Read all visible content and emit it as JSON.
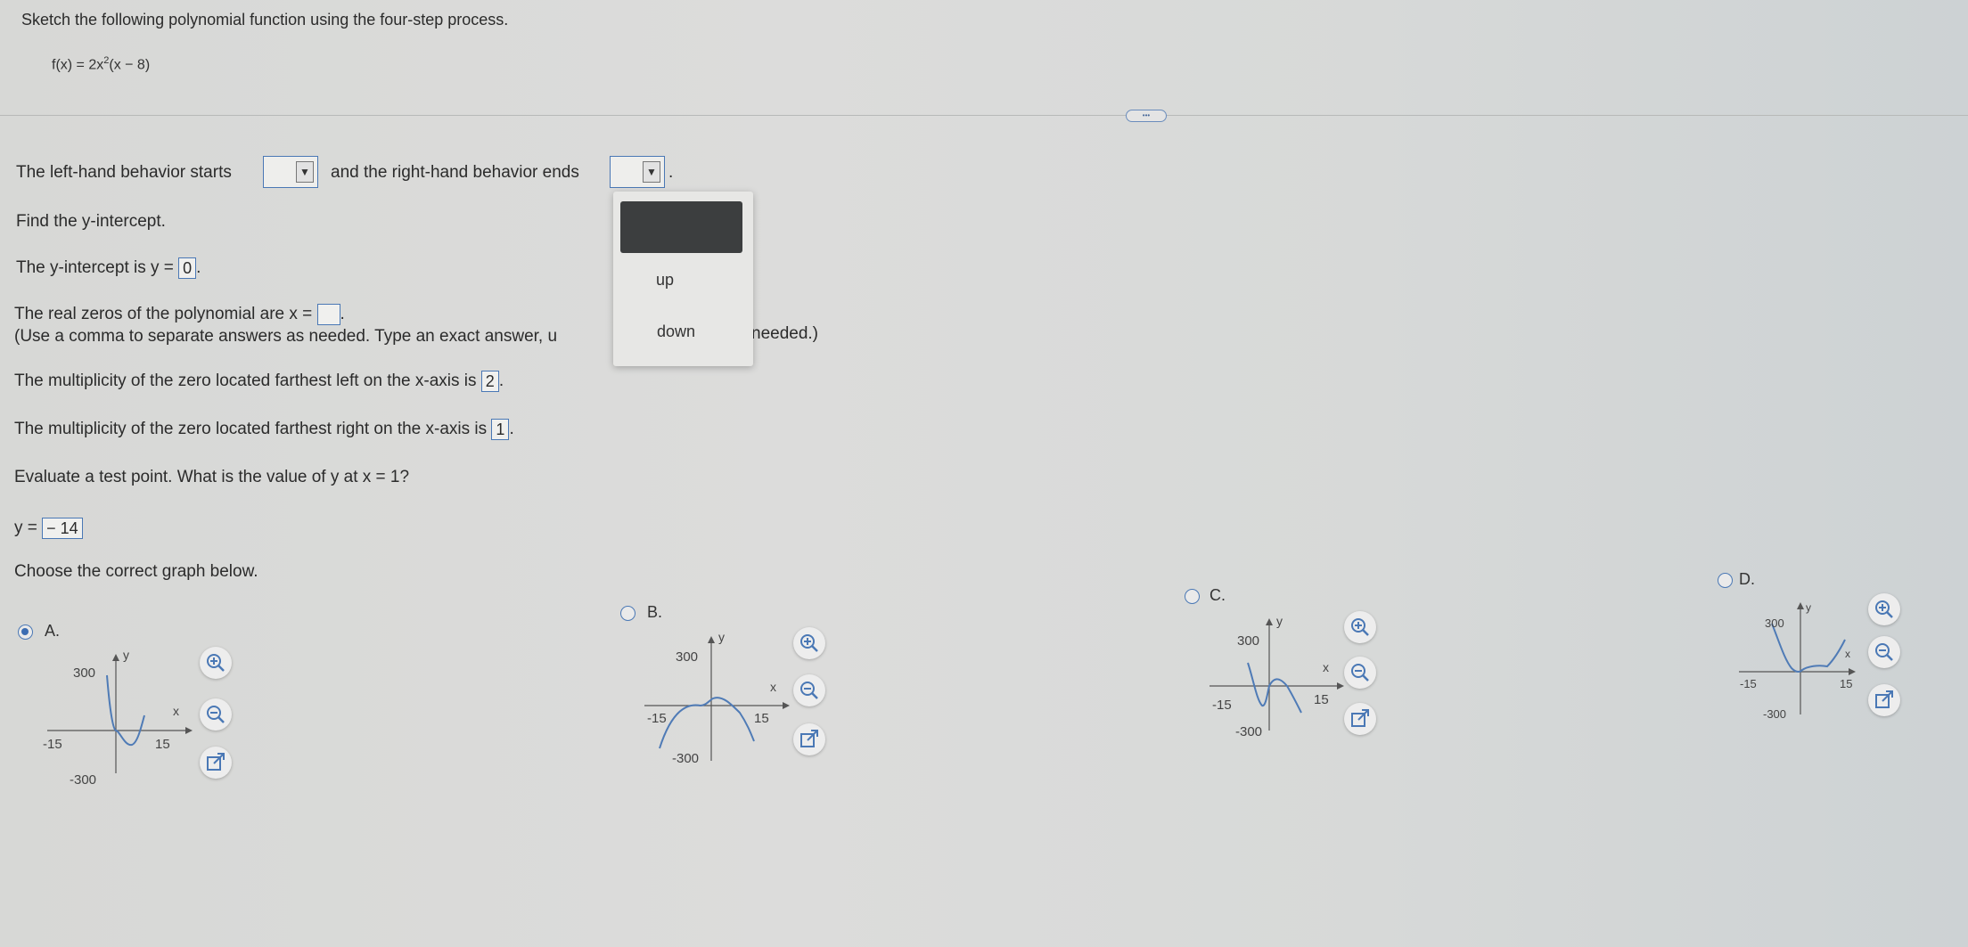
{
  "header": {
    "instruction": "Sketch the following polynomial function using the four-step process.",
    "function_prefix": "f(x) = 2x",
    "function_exp": "2",
    "function_suffix": "(x − 8)",
    "more_button": "•••"
  },
  "behavior": {
    "left_label": "The left-hand behavior starts",
    "right_label": "and the right-hand behavior ends",
    "period": ".",
    "left_value": "",
    "right_value": "",
    "dropdown_options": [
      "",
      "up",
      "down"
    ]
  },
  "intercept": {
    "heading": "Find the y-intercept.",
    "label": "The y-intercept is y =",
    "value": "0",
    "period": "."
  },
  "zeros": {
    "label": "The real zeros of the polynomial are x =",
    "value": "",
    "period": ".",
    "hint_left": "(Use a comma to separate answers as needed. Type an exact answer, u",
    "hint_right": "needed.)"
  },
  "multiplicity": {
    "left_label": "The multiplicity of the zero located farthest left on the x-axis is",
    "left_value": "2",
    "right_label": "The multiplicity of the zero located farthest right on the x-axis is",
    "right_value": "1",
    "period": "."
  },
  "test_point": {
    "question": "Evaluate a test point. What is the value of y at x = 1?",
    "answer_label": "y =",
    "answer_value": "− 14"
  },
  "graph_choice": {
    "prompt": "Choose the correct graph below.",
    "selected": "A",
    "options": [
      {
        "letter": "A.",
        "ymax_label": "300",
        "ymin_label": "-300",
        "xmin_label": "-15",
        "xmax_label": "15",
        "x_axis": "x",
        "y_axis": "y"
      },
      {
        "letter": "B.",
        "ymax_label": "300",
        "ymin_label": "-300",
        "xmin_label": "-15",
        "xmax_label": "15",
        "x_axis": "x",
        "y_axis": "y"
      },
      {
        "letter": "C.",
        "ymax_label": "300",
        "ymin_label": "-300",
        "xmin_label": "-15",
        "xmax_label": "15",
        "x_axis": "x",
        "y_axis": "y"
      },
      {
        "letter": "D.",
        "ymax_label": "300",
        "ymin_label": "-300",
        "xmin_label": "-15",
        "xmax_label": "15",
        "x_axis": "x",
        "y_axis": "y"
      }
    ],
    "icons": [
      "zoom-in-icon",
      "zoom-out-icon",
      "open-external-icon"
    ]
  },
  "colors": {
    "accent": "#4a78b5",
    "curve": "#4f7bb6",
    "radio_selected": "#3c6db2"
  }
}
